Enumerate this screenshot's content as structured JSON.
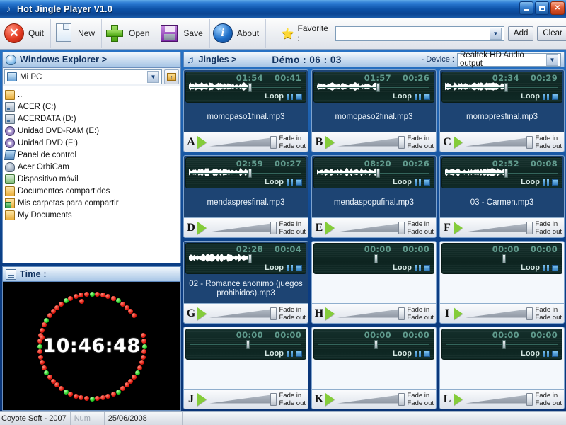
{
  "window": {
    "title": "Hot Jingle Player V1.0",
    "title_icon": "music-note-icon",
    "minimize": "minimize-icon",
    "maximize": "maximize-icon",
    "close": "close-icon"
  },
  "toolbar": {
    "quit_label": "Quit",
    "new_label": "New",
    "open_label": "Open",
    "save_label": "Save",
    "about_label": "About",
    "favorite_label": "Favorite :",
    "favorite_value": "",
    "add_label": "Add",
    "clear_label": "Clear"
  },
  "explorer": {
    "panel_title": "Windows Explorer >",
    "drive_value": "Mi PC",
    "up_button": "up-folder-icon",
    "items": [
      {
        "label": "..",
        "icon": "folder-icon"
      },
      {
        "label": "ACER (C:)",
        "icon": "drive-icon"
      },
      {
        "label": "ACERDATA (D:)",
        "icon": "drive-icon"
      },
      {
        "label": "Unidad DVD-RAM (E:)",
        "icon": "dvd-icon"
      },
      {
        "label": "Unidad DVD (F:)",
        "icon": "dvd-icon"
      },
      {
        "label": "Panel de control",
        "icon": "control-panel-icon"
      },
      {
        "label": "Acer OrbiCam",
        "icon": "camera-icon"
      },
      {
        "label": "Dispositivo móvil",
        "icon": "mobile-device-icon"
      },
      {
        "label": "Documentos compartidos",
        "icon": "folder-icon"
      },
      {
        "label": "Mis carpetas para compartir",
        "icon": "shared-folder-icon"
      },
      {
        "label": "My Documents",
        "icon": "folder-icon"
      }
    ]
  },
  "time_panel": {
    "panel_title": "Time :",
    "clock": "10:46:48",
    "dot_color_red": "#e01b10",
    "dot_color_green": "#22cc22"
  },
  "jingles": {
    "panel_title": "Jingles >",
    "demo_label": "Démo : 06 : 03",
    "device_label": "- Device :",
    "device_value": "Realtek HD Audio output",
    "loop_label": "Loop",
    "fade_in_label": "Fade in",
    "fade_out_label": "Fade out",
    "cells": [
      {
        "letter": "A",
        "name": "momopaso1final.mp3",
        "total": "01:54",
        "elapsed": "00:41",
        "loaded": true
      },
      {
        "letter": "B",
        "name": "momopaso2final.mp3",
        "total": "01:57",
        "elapsed": "00:26",
        "loaded": true
      },
      {
        "letter": "C",
        "name": "momopresfinal.mp3",
        "total": "02:34",
        "elapsed": "00:29",
        "loaded": true
      },
      {
        "letter": "D",
        "name": "mendaspresfinal.mp3",
        "total": "02:59",
        "elapsed": "00:27",
        "loaded": true
      },
      {
        "letter": "E",
        "name": "mendaspopufinal.mp3",
        "total": "08:20",
        "elapsed": "00:26",
        "loaded": true
      },
      {
        "letter": "F",
        "name": "03 - Carmen.mp3",
        "total": "02:52",
        "elapsed": "00:08",
        "loaded": true
      },
      {
        "letter": "G",
        "name": "02 - Romance anonimo (juegos prohibidos).mp3",
        "total": "02:28",
        "elapsed": "00:04",
        "loaded": true
      },
      {
        "letter": "H",
        "name": "",
        "total": "00:00",
        "elapsed": "00:00",
        "loaded": false
      },
      {
        "letter": "I",
        "name": "",
        "total": "00:00",
        "elapsed": "00:00",
        "loaded": false
      },
      {
        "letter": "J",
        "name": "",
        "total": "00:00",
        "elapsed": "00:00",
        "loaded": false
      },
      {
        "letter": "K",
        "name": "",
        "total": "00:00",
        "elapsed": "00:00",
        "loaded": false
      },
      {
        "letter": "L",
        "name": "",
        "total": "00:00",
        "elapsed": "00:00",
        "loaded": false
      }
    ]
  },
  "status_bar": {
    "copyright": "Coyote Soft - 2007",
    "num": "Num",
    "date": "25/06/2008"
  }
}
